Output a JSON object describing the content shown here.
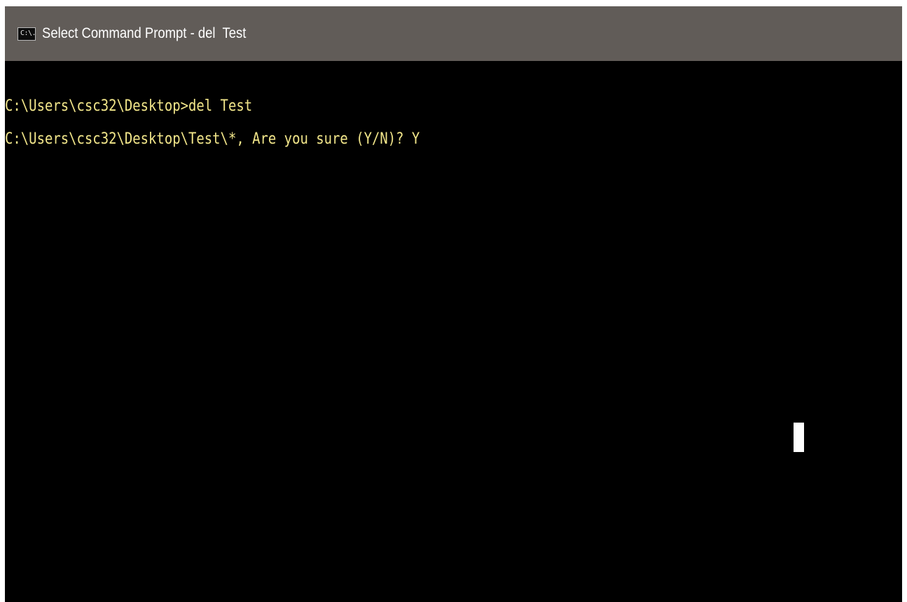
{
  "window": {
    "title": "Select Command Prompt - del  Test",
    "icon_name": "command-prompt-icon",
    "icon_glyph": "C:\\.",
    "colors": {
      "titlebar": "#615c58",
      "console_background": "#000000",
      "console_text": "#f2e68a"
    }
  },
  "console": {
    "lines": [
      "C:\\Users\\csc32\\Desktop>del Test",
      "C:\\Users\\csc32\\Desktop\\Test\\*, Are you sure (Y/N)? Y"
    ]
  },
  "mouse_cursor": {
    "icon_name": "text-cursor-block"
  }
}
